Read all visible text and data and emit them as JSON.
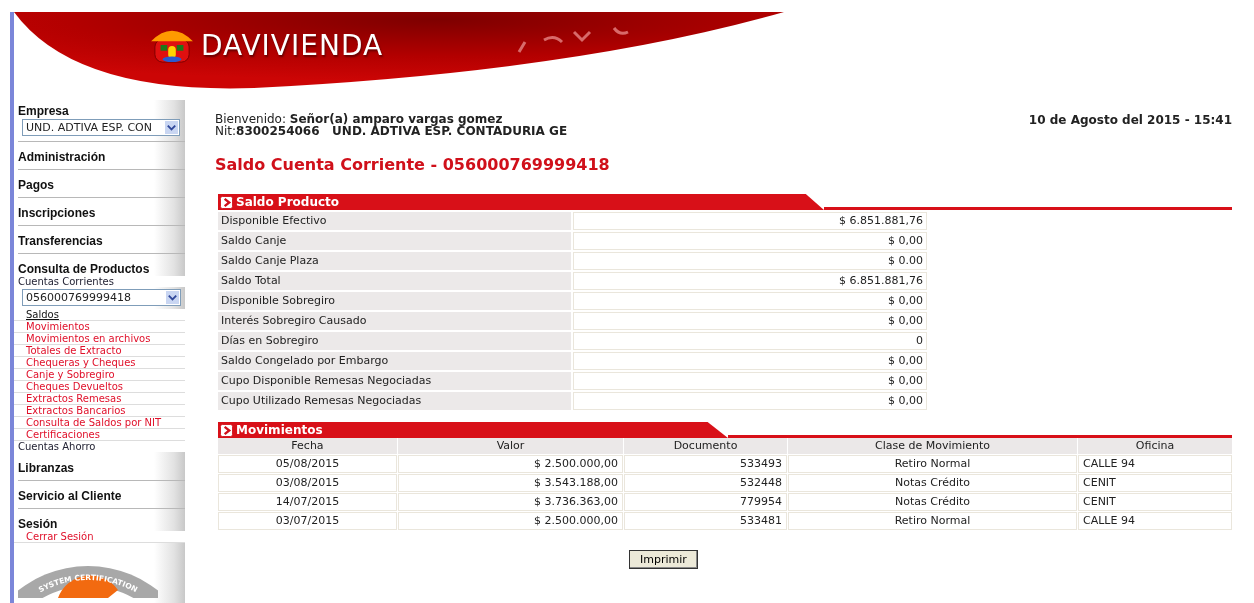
{
  "header": {
    "logo": "DAVIVIENDA"
  },
  "sidebar": {
    "company": {
      "label": "Empresa",
      "value": "UND. ADTIVA ESP. CON"
    },
    "sections": [
      {
        "title": "Administración"
      },
      {
        "title": "Pagos"
      },
      {
        "title": "Inscripciones"
      },
      {
        "title": "Transferencias"
      },
      {
        "title": "Consulta de Productos",
        "groups": [
          {
            "label": "Cuentas Corrientes",
            "account": "056000769999418",
            "links": [
              {
                "label": "Saldos",
                "selected": true
              },
              {
                "label": "Movimientos",
                "selected": false
              },
              {
                "label": "Movimientos en archivos",
                "selected": false
              },
              {
                "label": "Totales de Extracto",
                "selected": false
              },
              {
                "label": "Chequeras y Cheques",
                "selected": false
              },
              {
                "label": "Canje y Sobregiro",
                "selected": false
              },
              {
                "label": "Cheques Devueltos",
                "selected": false
              },
              {
                "label": "Extractos Remesas",
                "selected": false
              },
              {
                "label": "Extractos Bancarios",
                "selected": false
              },
              {
                "label": "Consulta de Saldos por NIT",
                "selected": false
              },
              {
                "label": "Certificaciones",
                "selected": false
              }
            ]
          },
          {
            "label": "Cuentas Ahorro"
          }
        ]
      },
      {
        "title": "Libranzas"
      },
      {
        "title": "Servicio al Cliente"
      },
      {
        "title": "Sesión",
        "links": [
          {
            "label": "Cerrar Sesión"
          }
        ]
      }
    ],
    "badge": "SYSTEM CERTIFICATION"
  },
  "welcome": {
    "greeting": "Bienvenido: **Señor(a) amparo vargas gomez**",
    "nit": "Nit:**8300254066   UND. ADTIVA ESP. CONTADURIA GE**",
    "date": "10 de Agosto del 2015 - 15:41"
  },
  "title": "Saldo Cuenta Corriente - 056000769999418",
  "balance": {
    "title": "Saldo Producto",
    "rows": [
      {
        "label": "Disponible Efectivo",
        "value": "$ 6.851.881,76"
      },
      {
        "label": "Saldo Canje",
        "value": "$ 0,00"
      },
      {
        "label": "Saldo Canje Plaza",
        "value": "$ 0.00"
      },
      {
        "label": "Saldo Total",
        "value": "$ 6.851.881,76"
      },
      {
        "label": "Disponible Sobregiro",
        "value": "$ 0,00"
      },
      {
        "label": "Interés Sobregiro Causado",
        "value": "$ 0,00"
      },
      {
        "label": "Días en Sobregiro",
        "value": "0"
      },
      {
        "label": "Saldo Congelado por Embargo",
        "value": "$ 0,00"
      },
      {
        "label": "Cupo Disponible Remesas Negociadas",
        "value": "$ 0,00"
      },
      {
        "label": "Cupo Utilizado Remesas Negociadas",
        "value": "$ 0,00"
      }
    ]
  },
  "movements": {
    "title": "Movimientos",
    "columns": [
      "Fecha",
      "Valor",
      "Documento",
      "Clase de Movimiento",
      "Oficina"
    ],
    "rows": [
      [
        "05/08/2015",
        "$ 2.500.000,00",
        "533493",
        "Retiro Normal",
        "CALLE 94"
      ],
      [
        "03/08/2015",
        "$ 3.543.188,00",
        "532448",
        "Notas Crédito",
        "CENIT"
      ],
      [
        "14/07/2015",
        "$ 3.736.363,00",
        "779954",
        "Notas Crédito",
        "CENIT"
      ],
      [
        "03/07/2015",
        "$ 2.500.000,00",
        "533481",
        "Retiro Normal",
        "CALLE 94"
      ]
    ]
  },
  "print_button": "Imprimir"
}
